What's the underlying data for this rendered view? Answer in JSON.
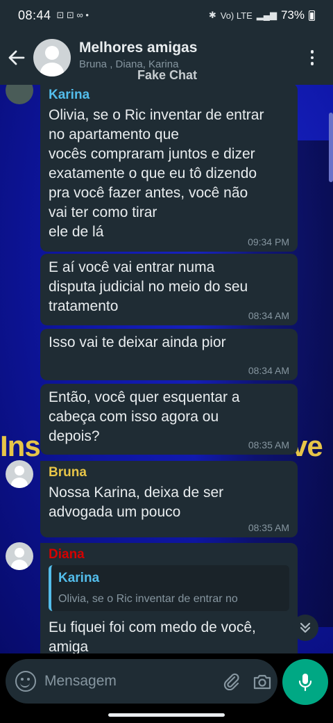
{
  "status_bar": {
    "time": "08:44",
    "battery": "73%",
    "network": "Vo) LTE"
  },
  "header": {
    "title": "Melhores amigas",
    "members": "Bruna , Diana, Karina",
    "watermark": "Fake Chat"
  },
  "overlay_text": {
    "left": "Ins",
    "right": "ve"
  },
  "messages": [
    {
      "sender": "Karina",
      "sender_color": "#53bdeb",
      "text": "Olivia, se o Ric inventar de entrar\nno apartamento que\nvocês compraram juntos e dizer\nexatamente o que eu tô dizendo\npra você fazer antes, você não\nvai ter como tirar\nele de lá",
      "time": "09:34 PM"
    },
    {
      "text": "E aí você vai entrar numa\ndisputa judicial no meio do seu\ntratamento",
      "time": "08:34 AM"
    },
    {
      "text": "Isso vai te deixar ainda pior",
      "time": "08:34 AM"
    },
    {
      "text": "Então, você quer esquentar a\ncabeça com isso agora ou\ndepois?",
      "time": "08:35 AM"
    },
    {
      "sender": "Bruna",
      "sender_color": "#e7c548",
      "text": "Nossa Karina, deixa de ser\nadvogada um pouco",
      "time": "08:35 AM"
    },
    {
      "sender": "Diana",
      "sender_color": "#d50000",
      "quote": {
        "sender": "Karina",
        "text": "Olivia, se o Ric inventar de entrar no"
      },
      "text": "Eu fiquei foi com medo de você,\namiga"
    }
  ],
  "composer": {
    "placeholder": "Mensagem"
  },
  "colors": {
    "accent": "#00a884",
    "bubble": "#1f2c34",
    "header": "#1f2c34"
  }
}
